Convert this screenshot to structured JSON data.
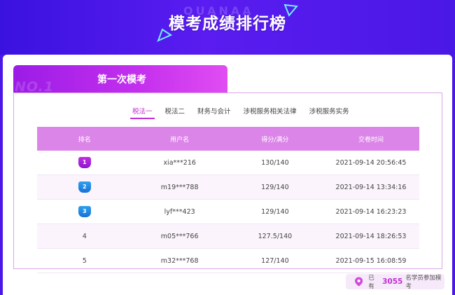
{
  "banner": {
    "ghost": "QUANAA",
    "title": "模考成绩排行榜"
  },
  "exam": {
    "no_badge": "NO.1",
    "title": "第一次模考"
  },
  "subtabs": [
    "税法一",
    "税法二",
    "财务与会计",
    "涉税服务相关法律",
    "涉税服务实务"
  ],
  "table": {
    "headers": [
      "排名",
      "用户名",
      "得分/满分",
      "交卷时间"
    ],
    "rows": [
      {
        "rank": "1",
        "user": "xia***216",
        "score": "130/140",
        "time": "2021-09-14 20:56:45"
      },
      {
        "rank": "2",
        "user": "m19***788",
        "score": "129/140",
        "time": "2021-09-14 13:34:16"
      },
      {
        "rank": "3",
        "user": "lyf***423",
        "score": "129/140",
        "time": "2021-09-14 16:23:23"
      },
      {
        "rank": "4",
        "user": "m05***766",
        "score": "127.5/140",
        "time": "2021-09-14 18:26:53"
      },
      {
        "rank": "5",
        "user": "m32***768",
        "score": "127/140",
        "time": "2021-09-15 16:08:59"
      }
    ]
  },
  "footer": {
    "prefix": "已有",
    "count": "3055",
    "suffix": "名学员参加模考"
  },
  "colors": {
    "background": "#4b16e8",
    "accent": "#c12fd2",
    "header_row": "#dc85e8"
  }
}
